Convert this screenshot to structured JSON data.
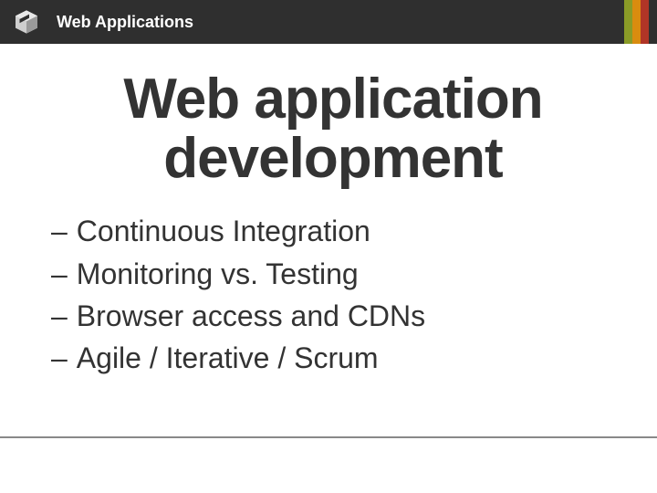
{
  "header": {
    "title": "Web Applications",
    "stripe_colors": [
      "#8a9b27",
      "#d98c0f",
      "#b03526",
      "#2f2f2f"
    ]
  },
  "main": {
    "title": "Web application development",
    "bullets": [
      "Continuous Integration",
      "Monitoring vs. Testing",
      "Browser access and CDNs",
      "Agile / Iterative / Scrum"
    ]
  }
}
